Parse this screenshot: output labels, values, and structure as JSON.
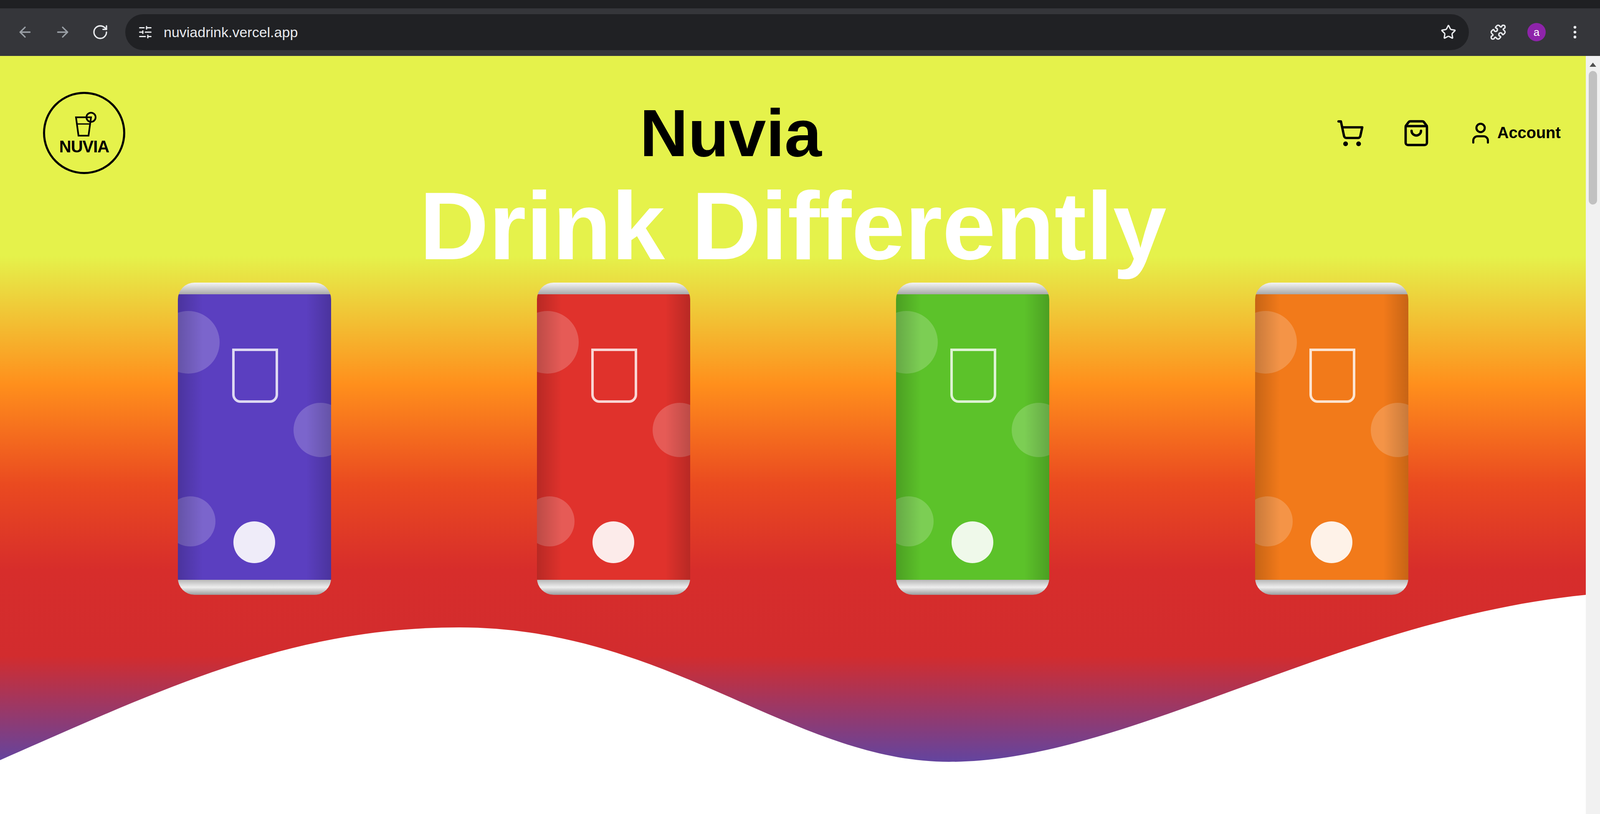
{
  "browser": {
    "url": "nuviadrink.vercel.app",
    "profile_initial": "a"
  },
  "header": {
    "logo_text": "NUVIA",
    "title": "Nuvia",
    "account_label": "Account"
  },
  "hero": {
    "headline": "Drink Differently",
    "cans": [
      {
        "color": "#5b3fc0"
      },
      {
        "color": "#e0322c"
      },
      {
        "color": "#5cc22a"
      },
      {
        "color": "#f27a1a"
      }
    ]
  }
}
